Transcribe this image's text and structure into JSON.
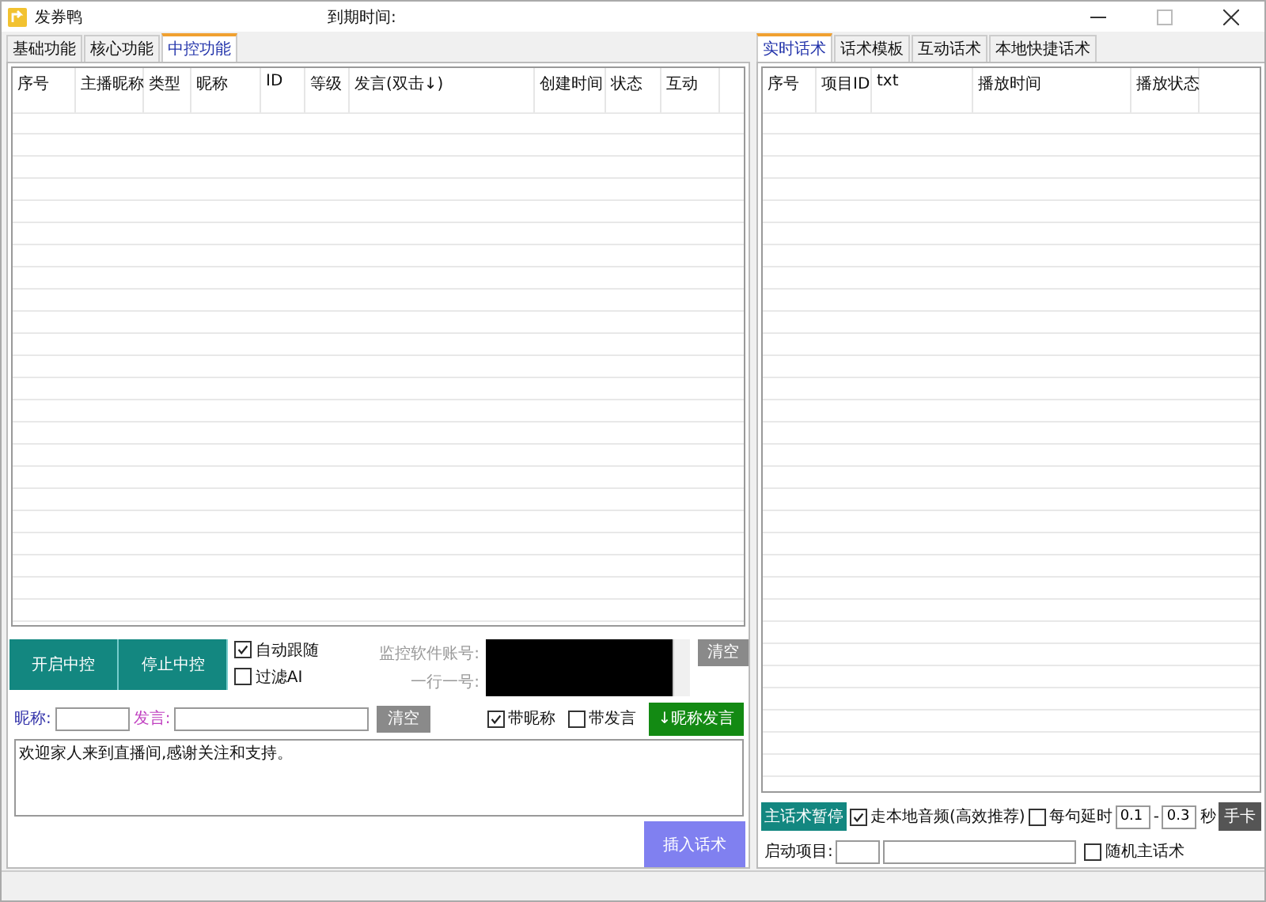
{
  "window": {
    "title": "发券鸭",
    "expiry_label": "到期时间:"
  },
  "left_tabs": [
    {
      "label": "基础功能",
      "selected": false
    },
    {
      "label": "核心功能",
      "selected": false
    },
    {
      "label": "中控功能",
      "selected": true
    }
  ],
  "event_table": {
    "columns": [
      "序号",
      "主播昵称",
      "类型",
      "昵称",
      "ID",
      "等级",
      "发言(双击↓)",
      "创建时间",
      "状态",
      "互动"
    ]
  },
  "control_buttons": [
    "开启中控",
    "停止中控"
  ],
  "follow_options": [
    {
      "label": "自动跟随",
      "checked": true
    },
    {
      "label": "过滤AI",
      "checked": false
    }
  ],
  "monitor": {
    "label": "监控软件账号:",
    "hint": "一行一号:",
    "clear": "清空"
  },
  "filter": {
    "nickname_label": "昵称:",
    "speech_label": "发言:",
    "clear": "清空"
  },
  "speech_options": [
    {
      "label": "带昵称",
      "checked": true
    },
    {
      "label": "带发言",
      "checked": false
    }
  ],
  "nickname_speech_button": "↓昵称发言",
  "script_text": "欢迎家人来到直播间,感谢关注和支持。",
  "insert_button": "插入话术",
  "right_tabs": [
    {
      "label": "实时话术",
      "selected": true
    },
    {
      "label": "话术模板",
      "selected": false
    },
    {
      "label": "互动话术",
      "selected": false
    },
    {
      "label": "本地快捷话术",
      "selected": false
    }
  ],
  "script_table": {
    "columns": [
      "序号",
      "项目ID",
      "txt",
      "播放时间",
      "播放状态"
    ]
  },
  "playback": {
    "pause_button": "主话术暂停",
    "local_audio": {
      "label": "走本地音频(高效推荐)",
      "checked": true
    },
    "delay": {
      "label": "每句延时",
      "checked": false
    },
    "delay_min": "0.1",
    "dash": "-",
    "delay_max": "0.3",
    "unit": "秒",
    "card_button": "手卡"
  },
  "start": {
    "label": "启动项目:",
    "random": {
      "label": "随机主话术",
      "checked": false
    }
  }
}
